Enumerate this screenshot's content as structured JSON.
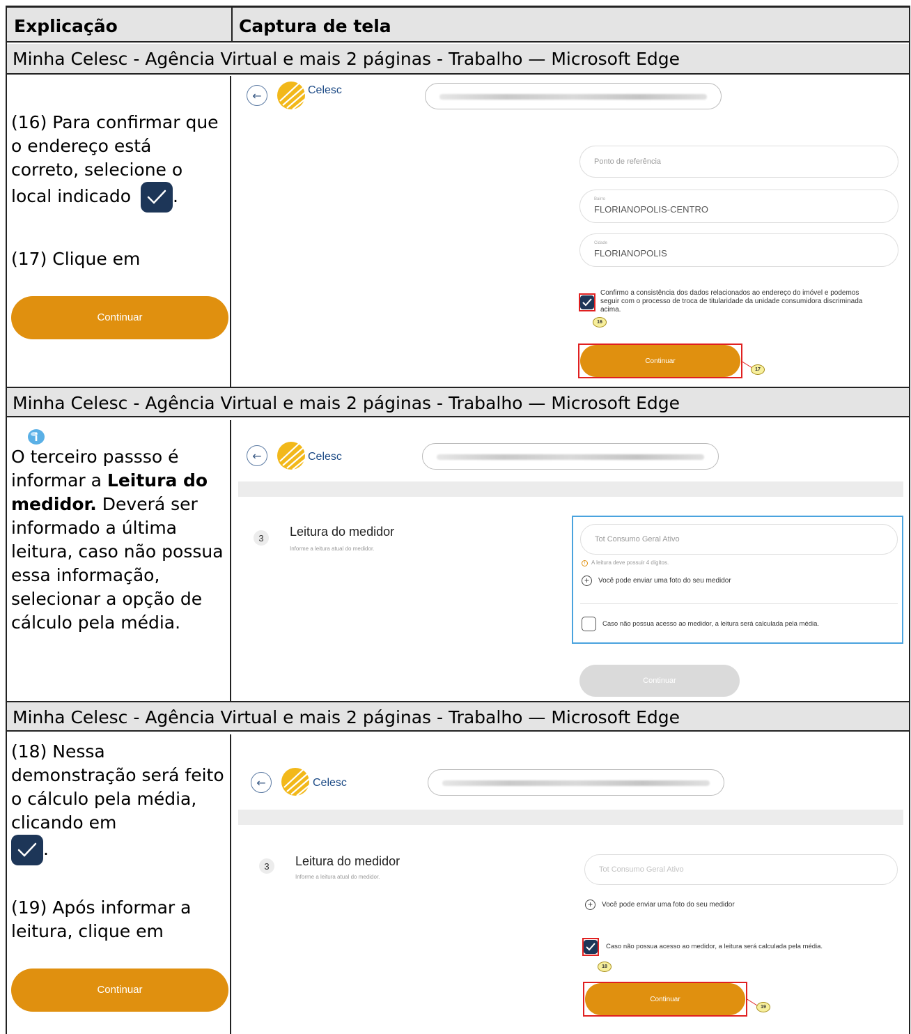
{
  "header": {
    "col1": "Explicação",
    "col2": "Captura de tela"
  },
  "window_title": "Minha Celesc - Agência Virtual e mais 2 páginas - Trabalho — Microsoft Edge",
  "section1": {
    "text_a": "(16) Para confirmar que o endereço está correto, selecione o local indicado",
    "text_a_end": ".",
    "text_b": "(17) Clique em",
    "button": "Continuar",
    "screenshot": {
      "brand": "Celesc",
      "field1_placeholder": "Ponto de referência",
      "field2_label": "Bairro",
      "field2_value": "FLORIANOPOLIS-CENTRO",
      "field3_label": "Cidade",
      "field3_value": "FLORIANOPOLIS",
      "confirm_text": "Confirmo a consistência dos dados relacionados ao endereço do imóvel e podemos seguir com o processo de troca de titularidade da unidade consumidora discriminada acima.",
      "button": "Continuar",
      "tag16": "16",
      "tag17": "17"
    }
  },
  "section2": {
    "text_intro": "O terceiro passso é informar a",
    "text_bold": "Leitura do medidor.",
    "text_rest": "Deverá ser informado a última leitura, caso não possua essa informação, selecionar a opção de cálculo pela média.",
    "screenshot": {
      "brand": "Celesc",
      "step": "3",
      "title": "Leitura do medidor",
      "subtitle": "Informe a leitura atual do medidor.",
      "input_placeholder": "Tot Consumo Geral Ativo",
      "warning": "A leitura deve possuir 4 dígitos.",
      "photo_link": "Você pode enviar uma foto do seu medidor",
      "checkbox_text": "Caso não possua acesso ao medidor, a leitura será calculada pela média.",
      "button": "Continuar"
    }
  },
  "section3": {
    "text_a": "(18) Nessa demonstração será feito o cálculo pela média, clicando em",
    "text_a_end": ".",
    "text_b": "(19) Após informar a leitura, clique em",
    "button": "Continuar",
    "screenshot": {
      "brand": "Celesc",
      "step": "3",
      "title": "Leitura do medidor",
      "subtitle": "Informe a leitura atual do medidor.",
      "input_placeholder": "Tot Consumo Geral Ativo",
      "photo_link": "Você pode enviar uma foto do seu medidor",
      "checkbox_text": "Caso não possua acesso ao medidor, a leitura será calculada pela média.",
      "button": "Continuar",
      "tag18": "18",
      "tag19": "19"
    }
  },
  "colors": {
    "orange": "#e0900f",
    "navy": "#1d3658",
    "red": "#e02020",
    "gray_header": "#e4e4e4"
  },
  "icons": [
    "check-icon",
    "back-arrow-icon",
    "celesc-logo",
    "info-icon",
    "plus-circle-icon",
    "warning-icon"
  ]
}
